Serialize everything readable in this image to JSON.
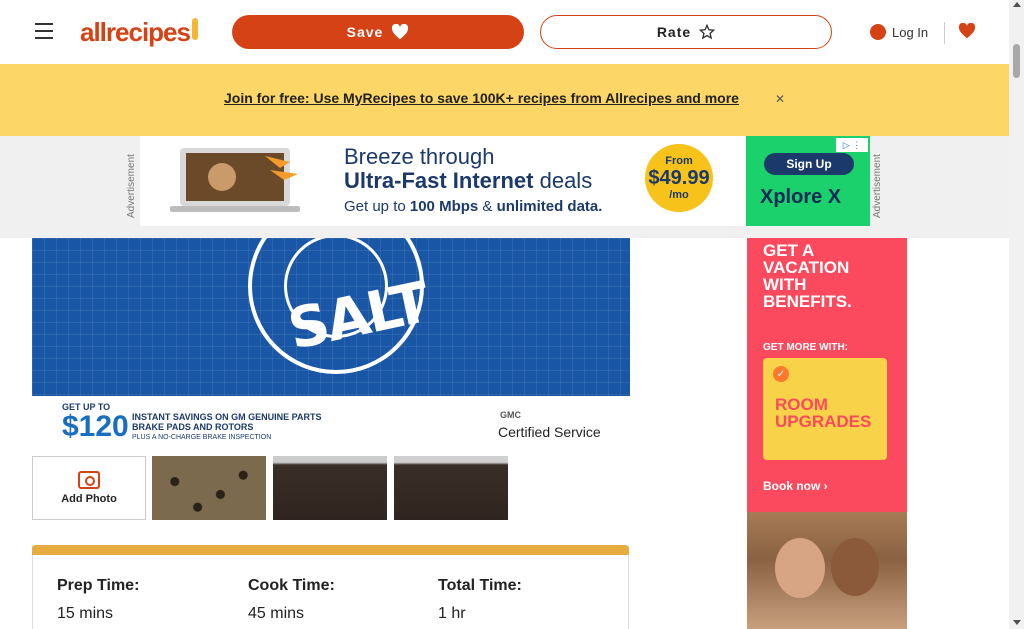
{
  "header": {
    "menu_icon": "hamburger-icon",
    "logo_text": "allrecipes",
    "save_label": "Save",
    "rate_label": "Rate",
    "login_label": "Log In",
    "saved_icon": "heart-icon"
  },
  "promo": {
    "text": "Join for free: Use MyRecipes to save 100K+ recipes from Allrecipes and more",
    "close_label": "✕",
    "background": "#fcd666"
  },
  "ad_banner": {
    "label": "Advertisement",
    "line1": "Breeze through",
    "line2_bold": "Ultra-Fast Internet",
    "line2_rest": " deals",
    "line3_pre": "Get up to ",
    "line3_b1": "100 Mbps",
    "line3_mid": " & ",
    "line3_b2": "unlimited data.",
    "price_from": "From",
    "price_amount": "$49.99",
    "price_unit": "/mo",
    "signup": "Sign Up",
    "brand": "Xplore X"
  },
  "hero_ad": {
    "brand_text": "SALT",
    "get_up_to": "GET UP TO",
    "amount": "$120",
    "instant": "INSTANT SAVINGS ON GM GENUINE PARTS BRAKE PADS AND ROTORS",
    "plus": "PLUS A NO-CHARGE BRAKE INSPECTION",
    "brands": "GMC",
    "certified": "Certified Service"
  },
  "photos": {
    "add_label": "Add Photo"
  },
  "details": {
    "accent": "#e6ac3f",
    "items": [
      {
        "label": "Prep Time:",
        "value": "15 mins"
      },
      {
        "label": "Cook Time:",
        "value": "45 mins"
      },
      {
        "label": "Total Time:",
        "value": "1 hr"
      }
    ]
  },
  "side_ad": {
    "headline": "GET A VACATION WITH BENEFITS.",
    "more": "GET MORE WITH:",
    "card": "ROOM UPGRADES",
    "book": "Book now"
  },
  "colors": {
    "brand": "#d54215"
  }
}
